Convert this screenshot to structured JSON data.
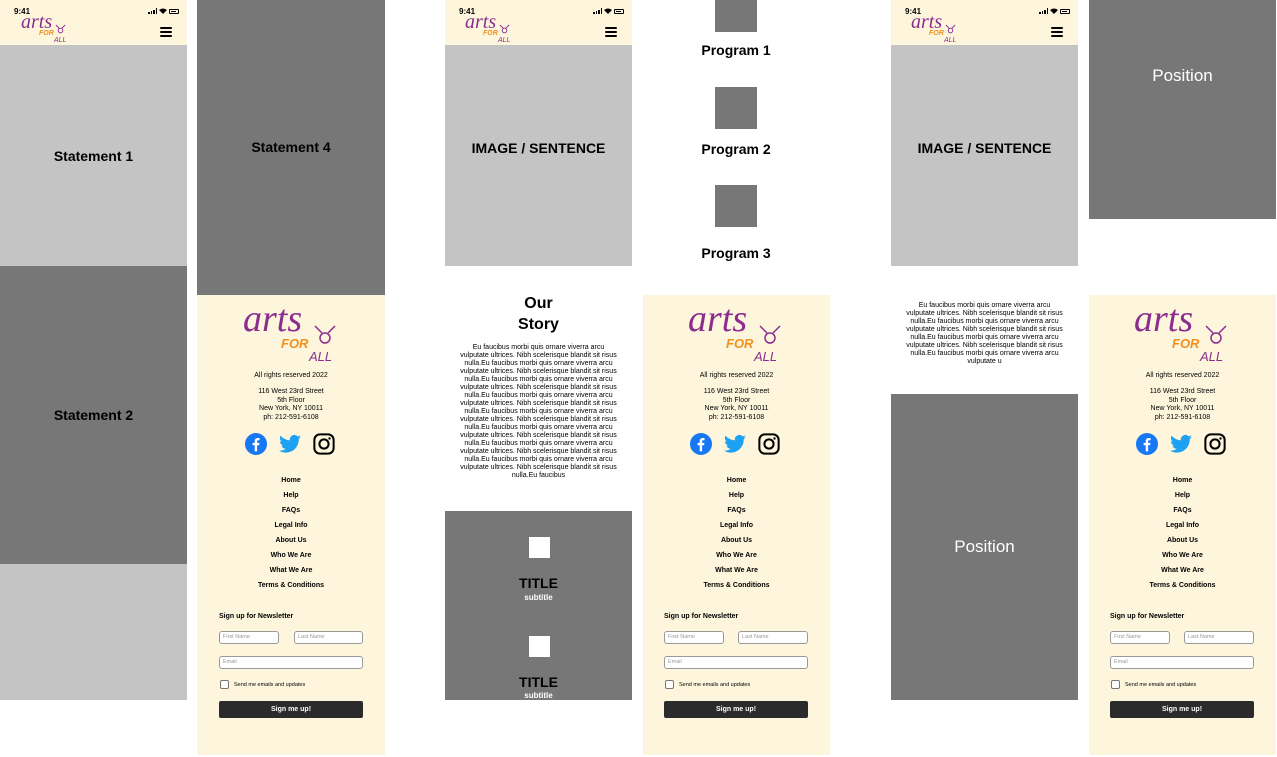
{
  "brand": {
    "arts": "arts",
    "for": "FOR",
    "all": "ALL"
  },
  "status_bar": {
    "time": "9:41"
  },
  "screen1": {
    "statement1": "Statement 1",
    "statement2": "Statement 2"
  },
  "screen2": {
    "statement4": "Statement 4"
  },
  "screen3": {
    "hero": "IMAGE / SENTENCE",
    "story_title_line1": "Our",
    "story_title_line2": "Story",
    "story_body": "Eu faucibus morbi quis ornare viverra arcu vulputate ultrices. Nibh scelerisque blandit sit risus nulla.Eu faucibus morbi quis ornare viverra arcu vulputate ultrices. Nibh scelerisque blandit sit risus nulla.Eu faucibus morbi quis ornare viverra arcu vulputate ultrices. Nibh scelerisque blandit sit risus nulla.Eu faucibus morbi quis ornare viverra arcu vulputate ultrices. Nibh scelerisque blandit sit risus nulla.Eu faucibus morbi quis ornare viverra arcu vulputate ultrices. Nibh scelerisque blandit sit risus nulla.Eu faucibus morbi quis ornare viverra arcu vulputate ultrices. Nibh scelerisque blandit sit risus nulla.Eu faucibus morbi quis ornare viverra arcu vulputate ultrices. Nibh scelerisque blandit sit risus nulla.Eu faucibus morbi quis ornare viverra arcu vulputate ultrices. Nibh scelerisque blandit sit risus nulla.Eu faucibus",
    "card1_title": "TITLE",
    "card1_subtitle": "subtitle",
    "card2_title": "TITLE",
    "card2_subtitle": "subtitle"
  },
  "screen4": {
    "program1": "Program 1",
    "program2": "Program 2",
    "program3": "Program 3"
  },
  "screen5": {
    "hero": "IMAGE / SENTENCE",
    "body": "Eu faucibus morbi quis ornare viverra arcu vulputate ultrices. Nibh scelerisque blandit sit risus nulla.Eu faucibus morbi quis ornare viverra arcu vulputate ultrices. Nibh scelerisque blandit sit risus nulla.Eu faucibus morbi quis ornare viverra arcu vulputate ultrices. Nibh scelerisque blandit sit risus nulla.Eu faucibus morbi quis ornare viverra arcu vulputate u",
    "position": "Position"
  },
  "screen6": {
    "position": "Position"
  },
  "footer": {
    "rights": "All rights reserved 2022",
    "address1": "116 West 23rd Street",
    "address2": "5th Floor",
    "address3": "New York, NY 10011",
    "phone": "ph: 212-591-6108",
    "social": [
      "facebook-icon",
      "twitter-icon",
      "instagram-icon"
    ],
    "nav": [
      "Home",
      "Help",
      "FAQs",
      "Legal Info",
      "About Us",
      "Who We Are",
      "What We Are",
      "Terms & Conditions"
    ],
    "newsletter_title": "Sign up for Newsletter",
    "first_name_placeholder": "First Name",
    "last_name_placeholder": "Last Name",
    "email_placeholder": "Email",
    "checkbox_label": "Send me emails and updates",
    "submit_label": "Sign me up!"
  },
  "colors": {
    "cream": "#fdf6dd",
    "light_gray": "#c4c4c4",
    "dark_gray": "#777777",
    "purple": "#8b2d8e",
    "orange": "#f0901e",
    "facebook": "#1877f2",
    "twitter": "#1da1f2"
  }
}
